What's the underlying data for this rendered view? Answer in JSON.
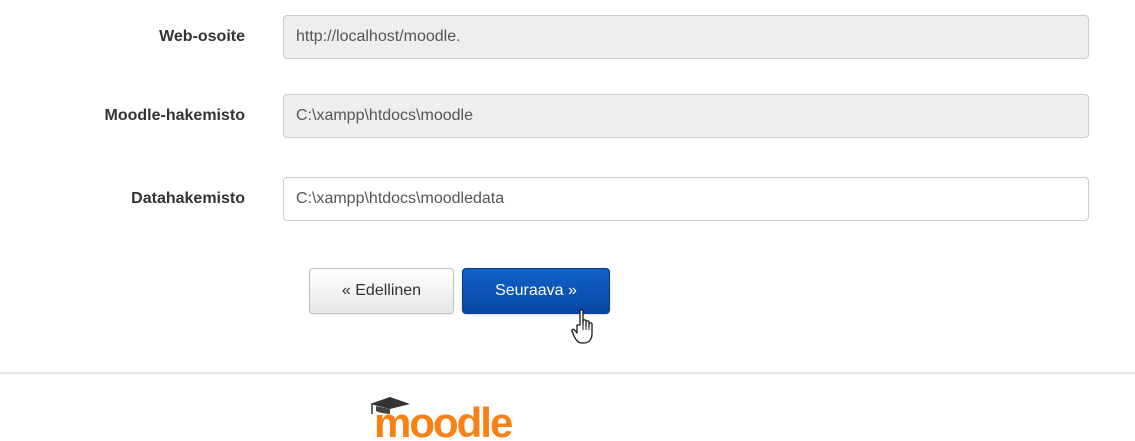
{
  "form": {
    "fields": [
      {
        "label": "Web-osoite",
        "value": "http://localhost/moodle.",
        "readonly": true
      },
      {
        "label": "Moodle-hakemisto",
        "value": "C:\\xampp\\htdocs\\moodle",
        "readonly": true
      },
      {
        "label": "Datahakemisto",
        "value": "C:\\xampp\\htdocs\\moodledata",
        "readonly": false
      }
    ]
  },
  "buttons": {
    "prev_label": "« Edellinen",
    "next_label": "Seuraava »"
  },
  "footer": {
    "logo_text": "moodle",
    "logo_icon": "mortarboard-icon"
  },
  "colors": {
    "primary_button": "#0a47a5",
    "logo_orange": "#f98012",
    "logo_cap": "#333333"
  }
}
